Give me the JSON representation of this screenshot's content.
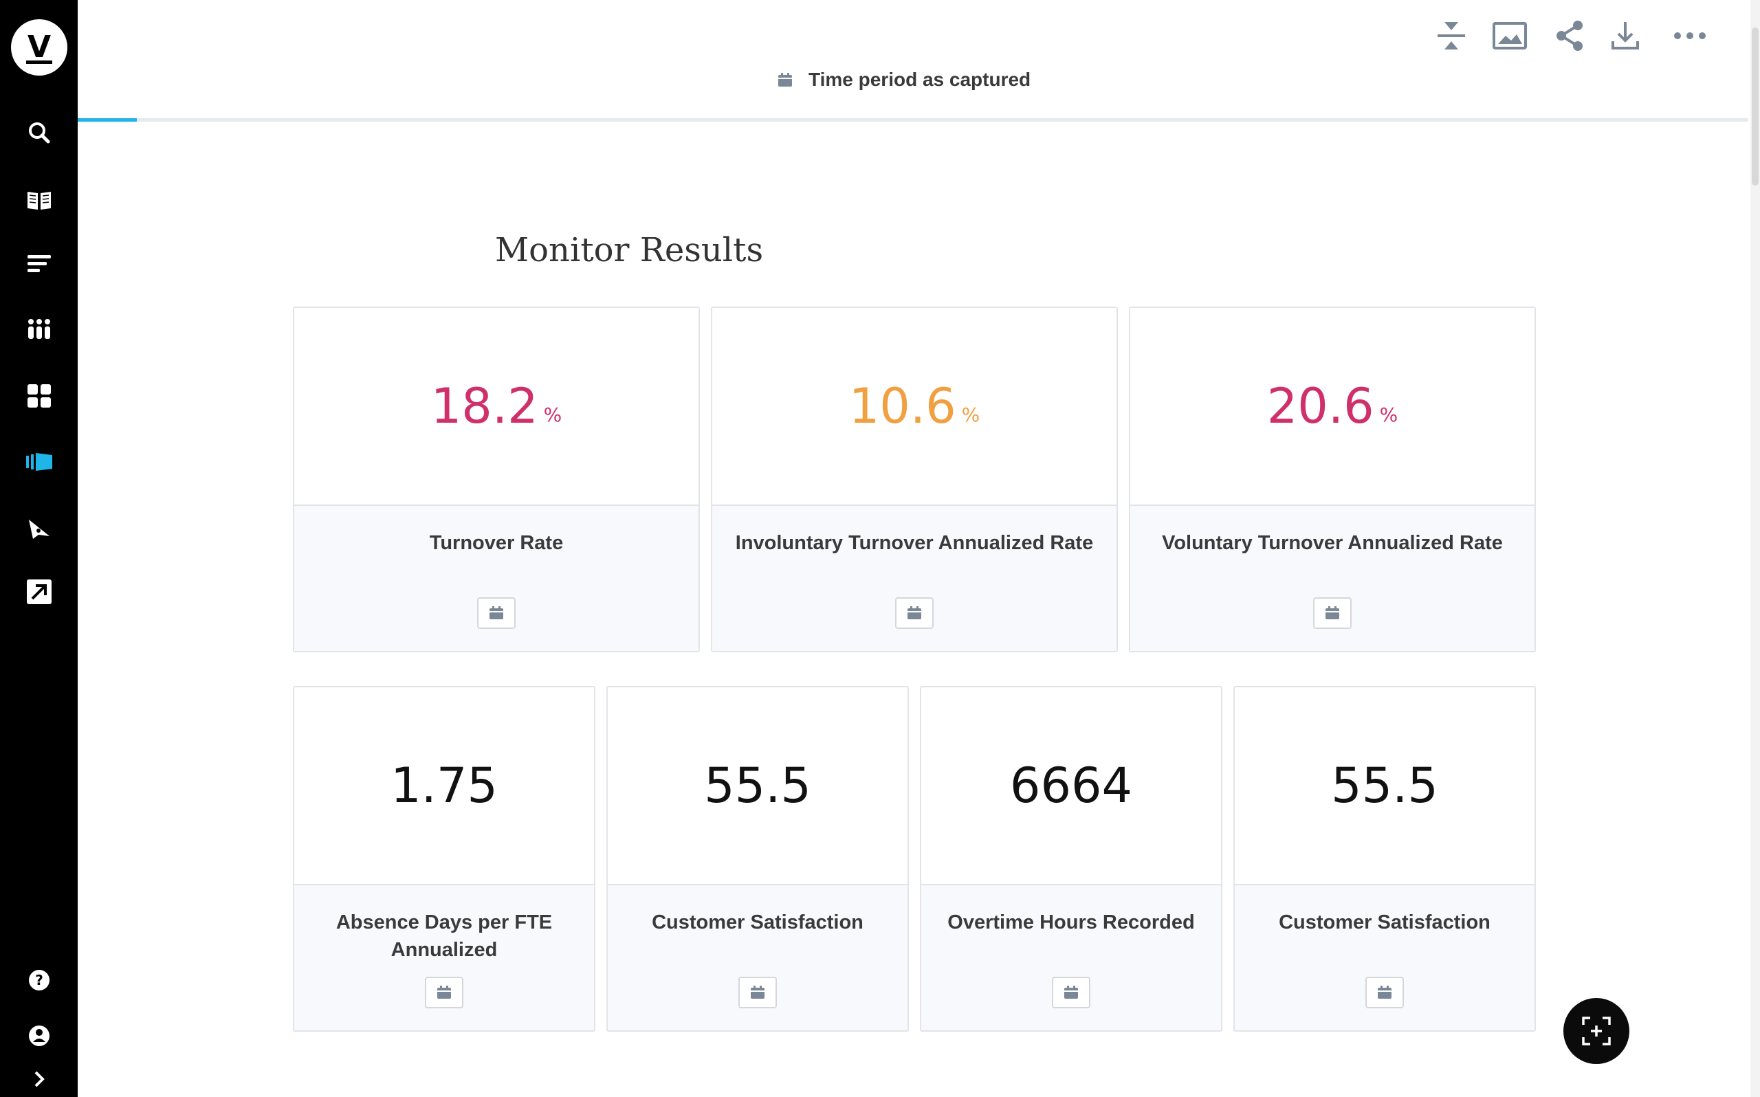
{
  "sidebar": {
    "logo_letter": "V",
    "items": [
      {
        "icon": "search-icon"
      },
      {
        "icon": "book-icon"
      },
      {
        "icon": "lines-icon"
      },
      {
        "icon": "dots-grid-icon"
      },
      {
        "icon": "tiles-icon"
      },
      {
        "icon": "presentation-icon",
        "active": true
      },
      {
        "icon": "compass-icon"
      },
      {
        "icon": "external-link-icon"
      },
      {
        "icon": "help-icon"
      },
      {
        "icon": "user-icon"
      },
      {
        "icon": "chevron-right-icon"
      }
    ]
  },
  "toolbar": {
    "tools": [
      "collapse-icon",
      "image-icon",
      "share-icon",
      "download-icon",
      "more-icon"
    ]
  },
  "header": {
    "period_label": "Time period as captured"
  },
  "page": {
    "title": "Monitor Results"
  },
  "cards": [
    {
      "value": "18.2",
      "unit": "%",
      "label": "Turnover Rate",
      "color": "#d0306a"
    },
    {
      "value": "10.6",
      "unit": "%",
      "label": "Involuntary Turnover Annualized Rate",
      "color": "#f0a040"
    },
    {
      "value": "20.6",
      "unit": "%",
      "label": "Voluntary Turnover Annualized Rate",
      "color": "#d0306a"
    },
    {
      "value": "1.75",
      "unit": "",
      "label": "Absence Days per FTE Annualized",
      "color": "#111111"
    },
    {
      "value": "55.5",
      "unit": "",
      "label": "Customer Satisfaction",
      "color": "#111111"
    },
    {
      "value": "6664",
      "unit": "",
      "label": "Overtime Hours Recorded",
      "color": "#111111"
    },
    {
      "value": "55.5",
      "unit": "",
      "label": "Customer Satisfaction",
      "color": "#111111"
    }
  ],
  "accent_color": "#1fb5e8"
}
